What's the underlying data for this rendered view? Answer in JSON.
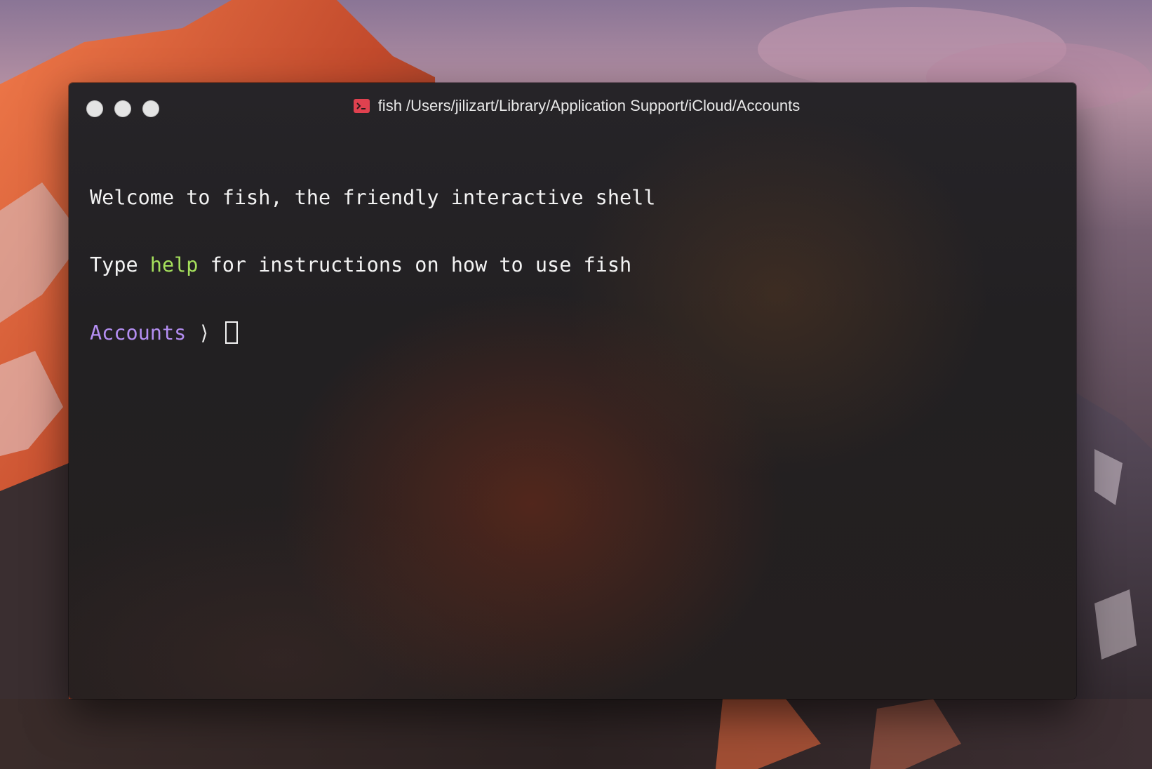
{
  "window": {
    "title": "fish /Users/jilizart/Library/Application Support/iCloud/Accounts",
    "title_icon": "terminal-icon",
    "traffic_lights": [
      "close",
      "minimize",
      "zoom"
    ]
  },
  "terminal": {
    "line1": "Welcome to fish, the friendly interactive shell",
    "line2_prefix": "Type ",
    "line2_command": "help",
    "line2_suffix": " for instructions on how to use fish",
    "prompt_dir": "Accounts",
    "prompt_symbol": " ⟩ ",
    "input_value": ""
  },
  "colors": {
    "command_highlight": "#a5e05c",
    "prompt_dir": "#b48ef2",
    "title_icon": "#e0414f"
  }
}
